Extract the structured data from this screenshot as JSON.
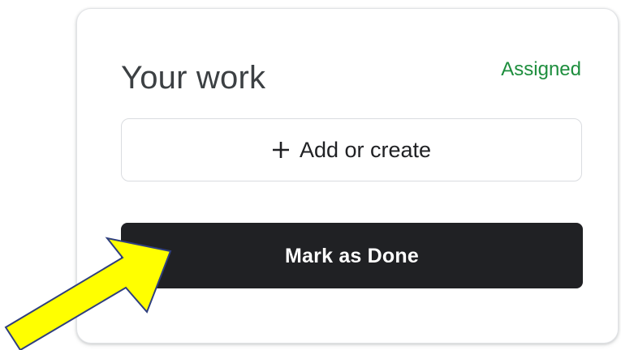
{
  "card": {
    "title": "Your work",
    "status": "Assigned",
    "add_button_label": "Add or create",
    "done_button_label": "Mark as Done"
  },
  "colors": {
    "status": "#1e8e3e",
    "primary_button": "#202124",
    "annotation_arrow_fill": "#ffff00",
    "annotation_arrow_stroke": "#2f3f7f"
  },
  "icons": {
    "add": "plus-icon",
    "annotation": "arrow-annotation"
  }
}
